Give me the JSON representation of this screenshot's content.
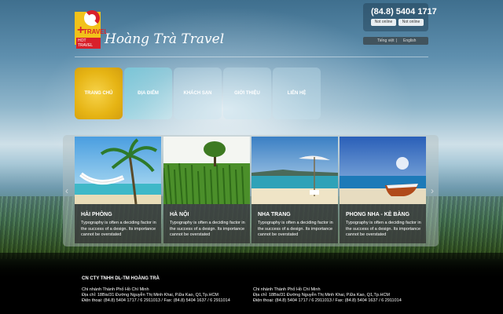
{
  "header": {
    "brand_name": "Hoàng Trà Travel",
    "logo": {
      "cross": "+",
      "line1": "TRAVEL",
      "line2": "HOT TRAVEL"
    },
    "phone": "(84.8) 5404 1717",
    "yahoo_labels": [
      "Not online",
      "Not online"
    ],
    "language": {
      "vi": "Tiếng việt",
      "sep": "|",
      "en": "English"
    }
  },
  "nav": [
    {
      "label": "TRANG CHỦ",
      "active": true
    },
    {
      "label": "ĐỊA ĐIỂM",
      "active": false
    },
    {
      "label": "KHÁCH SẠN",
      "active": false
    },
    {
      "label": "GIỚI THIỆU",
      "active": false
    },
    {
      "label": "LIÊN HỆ",
      "active": false
    }
  ],
  "slider": {
    "prev_arrow": "‹",
    "next_arrow": "›",
    "cards": [
      {
        "title": "HẢI PHÒNG",
        "desc": "Typography is often a deciding factor in the success of a design. Its importance cannot be overstated",
        "image": "hammock-palm-beach"
      },
      {
        "title": "HÀ NỘI",
        "desc": "Typography is often a deciding factor in the success of a design. Its importance cannot be overstated",
        "image": "green-field-tree"
      },
      {
        "title": "NHA TRANG",
        "desc": "Typography is often a deciding factor in the success of a design. Its importance cannot be overstated",
        "image": "beach-umbrella"
      },
      {
        "title": "PHONG NHA - KẺ BÀNG",
        "desc": "Typography is often a deciding factor in the success of a design. Its importance cannot be overstated",
        "image": "boat-on-beach"
      }
    ]
  },
  "footer": {
    "company": "CN CTY TNHH DL-TM HOÀNG TRÀ",
    "branches": [
      {
        "name": "Chi nhánh Thành Phố Hồ Chí Minh",
        "address": "Địa chỉ: 18Bis/31 Đường Nguyễn Thị Minh Khai, P.Đa Kao, Q1,Tp.HCM",
        "contact": "Điện thoại: (84.8) 5404 1717 / 6 2911013    /    Fax: (84.8) 5404 1637 / 6 2911014"
      },
      {
        "name": "Chi nhánh Thành Phố Hồ Chí Minh",
        "address": "Địa chỉ: 18Bis/31 Đường Nguyễn Thị Minh Khai, P.Đa Kao, Q1,Tp.HCM",
        "contact": "Điện thoại: (84.8) 5404 1717 / 6 2911013    /    Fax: (84.8) 5404 1637 / 6 2911014"
      }
    ]
  },
  "colors": {
    "accent_yellow": "#f2c21a",
    "logo_red": "#d8202a",
    "tile_cyan": "#78d2e1"
  }
}
